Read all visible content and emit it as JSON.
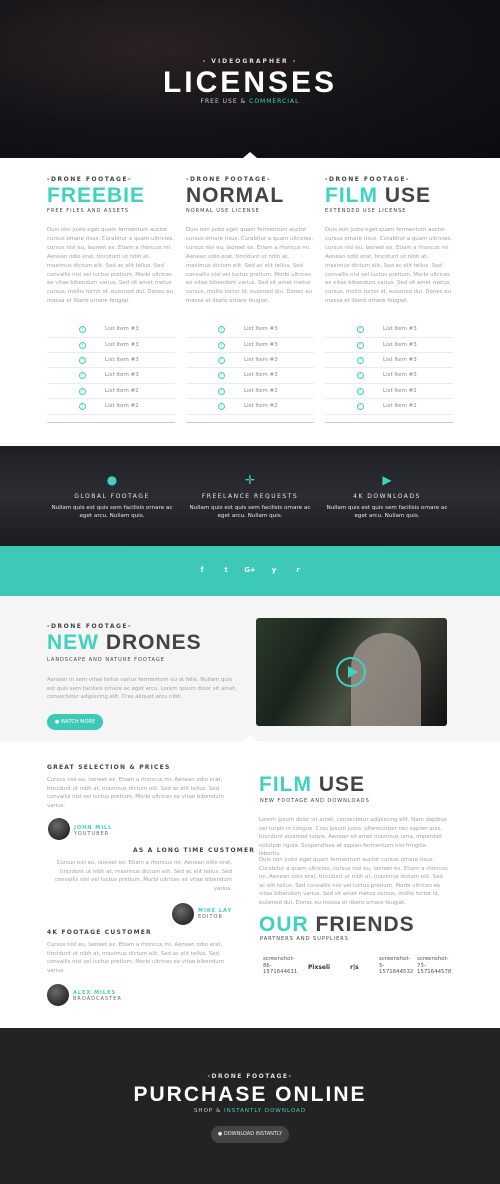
{
  "hero": {
    "kicker": "- VIDEOGRAPHER -",
    "title": "LICENSES",
    "sub_a": "FREE USE & ",
    "sub_b": "COMMERCIAL"
  },
  "licenses": [
    {
      "label": "-DRONE FOOTAGE-",
      "name_accent": "FREEBIE",
      "name_dark": "",
      "sub": "FREE FILES AND ASSETS",
      "desc": "Duis non justo eget quam fermentum auctor cursus ornare risus. Curabitur a quam ultricies, cursus nisl eu, laoreet ex. Etiam a rhoncus mi. Aenean odio erat, tincidunt ut nibh at, maximus dictum elit. Sed ac elit tellus.  Sed convallis nisi vel luctus pretium. Morbi ultrices ex vitae bibendum varius. Sed sit amet metus cursus, mollis tortor id, euismod dui. Donec eu massa et libero ornare feugiat.",
      "items": [
        "List Item #3",
        "List Item #3",
        "List Item #3",
        "List Item #3",
        "List Item #2",
        "List Item #2"
      ]
    },
    {
      "label": "-DRONE FOOTAGE-",
      "name_accent": "",
      "name_dark": "NORMAL",
      "sub": "NORMAL USE LICENSE",
      "desc": "Duis non justo eget quam fermentum auctor cursus ornare risus. Curabitur a quam ultricies, cursus nisl eu, laoreet ex. Etiam a rhoncus mi. Aenean odio erat, tincidunt ut nibh at, maximus dictum elit. Sed ac elit tellus.  Sed convallis nisi vel luctus pretium. Morbi ultrices ex vitae bibendum varius. Sed sit amet metus cursus, mollis tortor id, euismod dui. Donec eu massa et libero ornare feugiat.",
      "items": [
        "List Item #3",
        "List Item #3",
        "List Item #3",
        "List Item #3",
        "List Item #2",
        "List Item #2"
      ]
    },
    {
      "label": "-DRONE FOOTAGE-",
      "name_accent": "FILM",
      "name_dark": " USE",
      "sub": "EXTENDED USE LICENSE",
      "desc": "Duis non justo eget quam fermentum auctor cursus ornare risus. Curabitur a quam ultricies, cursus nisl eu, laoreet ex. Etiam a rhoncus mi. Aenean odio erat, tincidunt ut nibh at, maximus dictum elit. Sed ac elit tellus.  Sed convallis nisi vel luctus pretium. Morbi ultrices ex vitae bibendum varius. Sed sit amet metus cursus, mollis tortor id, euismod dui. Donec eu massa et libero ornare feugiat.",
      "items": [
        "List Item #3",
        "List Item #3",
        "List Item #3",
        "List Item #3",
        "List Item #2",
        "List Item #2"
      ]
    }
  ],
  "features": [
    {
      "icon": "globe-icon",
      "title": "GLOBAL FOOTAGE",
      "desc": "Nullam quis est quis sem facilisis ornare ac eget arcu. Nullam quis."
    },
    {
      "icon": "crosshair-icon",
      "title": "FREELANCE REQUESTS",
      "desc": "Nullam quis est quis sem facilisis ornare ac eget arcu. Nullam quis."
    },
    {
      "icon": "play-circle-icon",
      "title": "4K DOWNLOADS",
      "desc": "Nullam quis est quis sem facilisis ornare ac eget arcu. Nullam quis."
    }
  ],
  "social": [
    "f",
    "t",
    "G+",
    "y",
    "r"
  ],
  "new_drones": {
    "label": "-DRONE FOOTAGE-",
    "name_accent": "NEW",
    "name_dark": " DRONES",
    "sub": "LANDSCAPE AND NATURE FOOTAGE",
    "desc": "Aenean in sem vitae tellus varius fermentum eu at felis. Nullam quis est quis sem facilisis ornare ac eget arcu. Lorem ipsum dolor sit amet, consectetur adipiscing elit. Cras aliquet arcu nibh.",
    "button": "WATCH MORE"
  },
  "testimonials": [
    {
      "heading": "GREAT SELECTION & PRICES",
      "text": "Cursus nisl eu, laoreet ex. Etiam a rhoncus mi. Aenean odio erat, tincidunt ut nibh at, maximus dictum elit. Sed ac elit tellus. Sed convallis nisi vel luctus pretium. Morbi ultrices ex vitae bibendum varius.",
      "name": "JOHN MILL",
      "role": "YOUTUBER"
    },
    {
      "heading": "AS A LONG TIME CUSTOMER",
      "text": "Cursus nisl eu, laoreet ex. Etiam a rhoncus mi. Aenean odio erat, tincidunt ut nibh at, maximus dictum elit. Sed ac elit tellus. Sed convallis nisi vel luctus pretium. Morbi ultrices ex vitae bibendum varius.",
      "name": "MIKE LAY",
      "role": "EDITOR"
    },
    {
      "heading": "4K FOOTAGE CUSTOMER",
      "text": "Cursus nisl eu, laoreet ex. Etiam a rhoncus mi. Aenean odio erat, tincidunt ut nibh at, maximus dictum elit. Sed ac elit tellus. Sed convallis nisi vel luctus pretium. Morbi ultrices ex vitae bibendum varius.",
      "name": "ALEX MILES",
      "role": "BROADCASTER"
    }
  ],
  "film_use": {
    "name_accent": "FILM",
    "name_dark": " USE",
    "sub": "NEW FOOTAGE AND DOWNLOADS",
    "p1": "Lorem ipsum dolor sit amet, consectetur adipiscing elit. Nam dapibus vel turpis in congue. Cras ipsum justo, ullamcorper nec sapien quis, tincidunt euismod turpis. Aenean sit amet maximus urna, imperdiet volutpat ligula. Suspendisse at sapien fermentum nisi fringilla lobortis.",
    "p2": "Duis non justo eget quam fermentum auctor cursus ornare risus. Curabitur a quam ultricies, cursus nisl eu, laoreet ex. Etiam a rhoncus mi. Aenean odio erat, tincidunt ut nibh at, maximus dictum elit. Sed ac elit tellus.  Sed convallis nisi vel luctus pretium. Morbi ultrices ex vitae bibendum varius. Sed sit amet metus cursus, mollis tortor id, euismod dui. Donec eu massa et libero ornare feugiat."
  },
  "friends": {
    "name_accent": "OUR",
    "name_dark": " FRIENDS",
    "sub": "PARTNERS AND SUPPLIERS",
    "logos": [
      "screenshot-86-1571644611",
      "Pixseli",
      "r|s",
      "screenshot-5-1571644532",
      "screenshot-73-1571644578"
    ]
  },
  "purchase": {
    "label": "-DRONE FOOTAGE-",
    "title": "PURCHASE ONLINE",
    "sub_a": "SHOP & ",
    "sub_b": "INSTANTLY DOWNLOAD",
    "button": "DOWNLOAD INSTANTLY"
  },
  "colors": {
    "accent": "#3fd1c1",
    "dark": "#232323"
  }
}
